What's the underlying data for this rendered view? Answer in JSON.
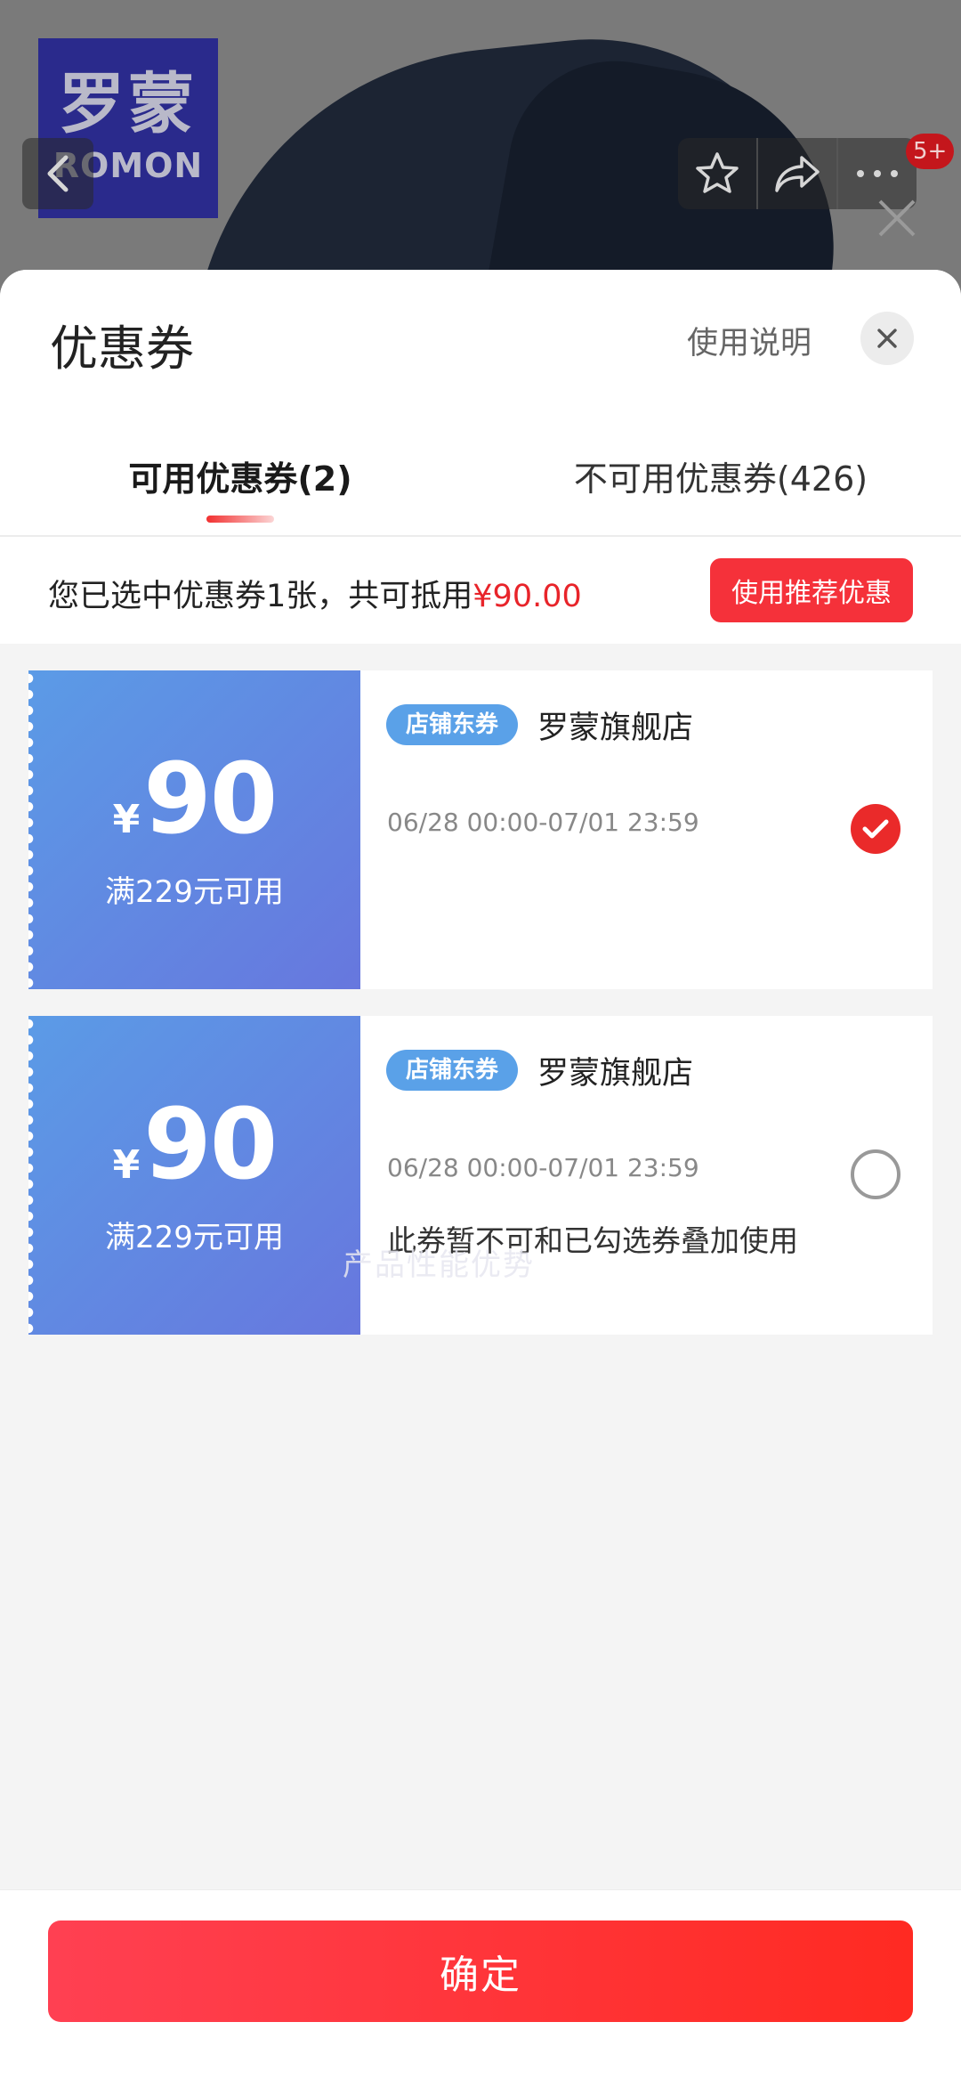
{
  "background": {
    "brand_logo_cn": "罗蒙",
    "brand_logo_en": "ROMON",
    "cart_badge": "5+",
    "icons": [
      "chevron-left-icon",
      "star-icon",
      "share-icon",
      "more-icon",
      "close-icon"
    ]
  },
  "sheet": {
    "title": "优惠券",
    "help_link": "使用说明",
    "tabs": [
      {
        "label": "可用优惠券(2)"
      },
      {
        "label": "不可用优惠券(426)"
      }
    ]
  },
  "summary": {
    "text": "您已选中优惠券1张，共可抵用",
    "amount": "¥90.00",
    "recommend_button": "使用推荐优惠"
  },
  "coupons": [
    {
      "currency": "¥",
      "value": "90",
      "condition": "满229元可用",
      "tag": "店铺东券",
      "shop": "罗蒙旗舰店",
      "time": "06/28 00:00-07/01 23:59",
      "note": "",
      "selected": true
    },
    {
      "currency": "¥",
      "value": "90",
      "condition": "满229元可用",
      "tag": "店铺东券",
      "shop": "罗蒙旗舰店",
      "time": "06/28 00:00-07/01 23:59",
      "note": "此券暂不可和已勾选券叠加使用",
      "selected": false
    }
  ],
  "watermark": "产品性能优势",
  "footer": {
    "confirm_button": "确定"
  },
  "colors": {
    "accent_red": "#f5313a",
    "coupon_blue": "#5b9be6",
    "coupon_purple": "#6777de",
    "tag_blue": "#5aa1e8"
  }
}
